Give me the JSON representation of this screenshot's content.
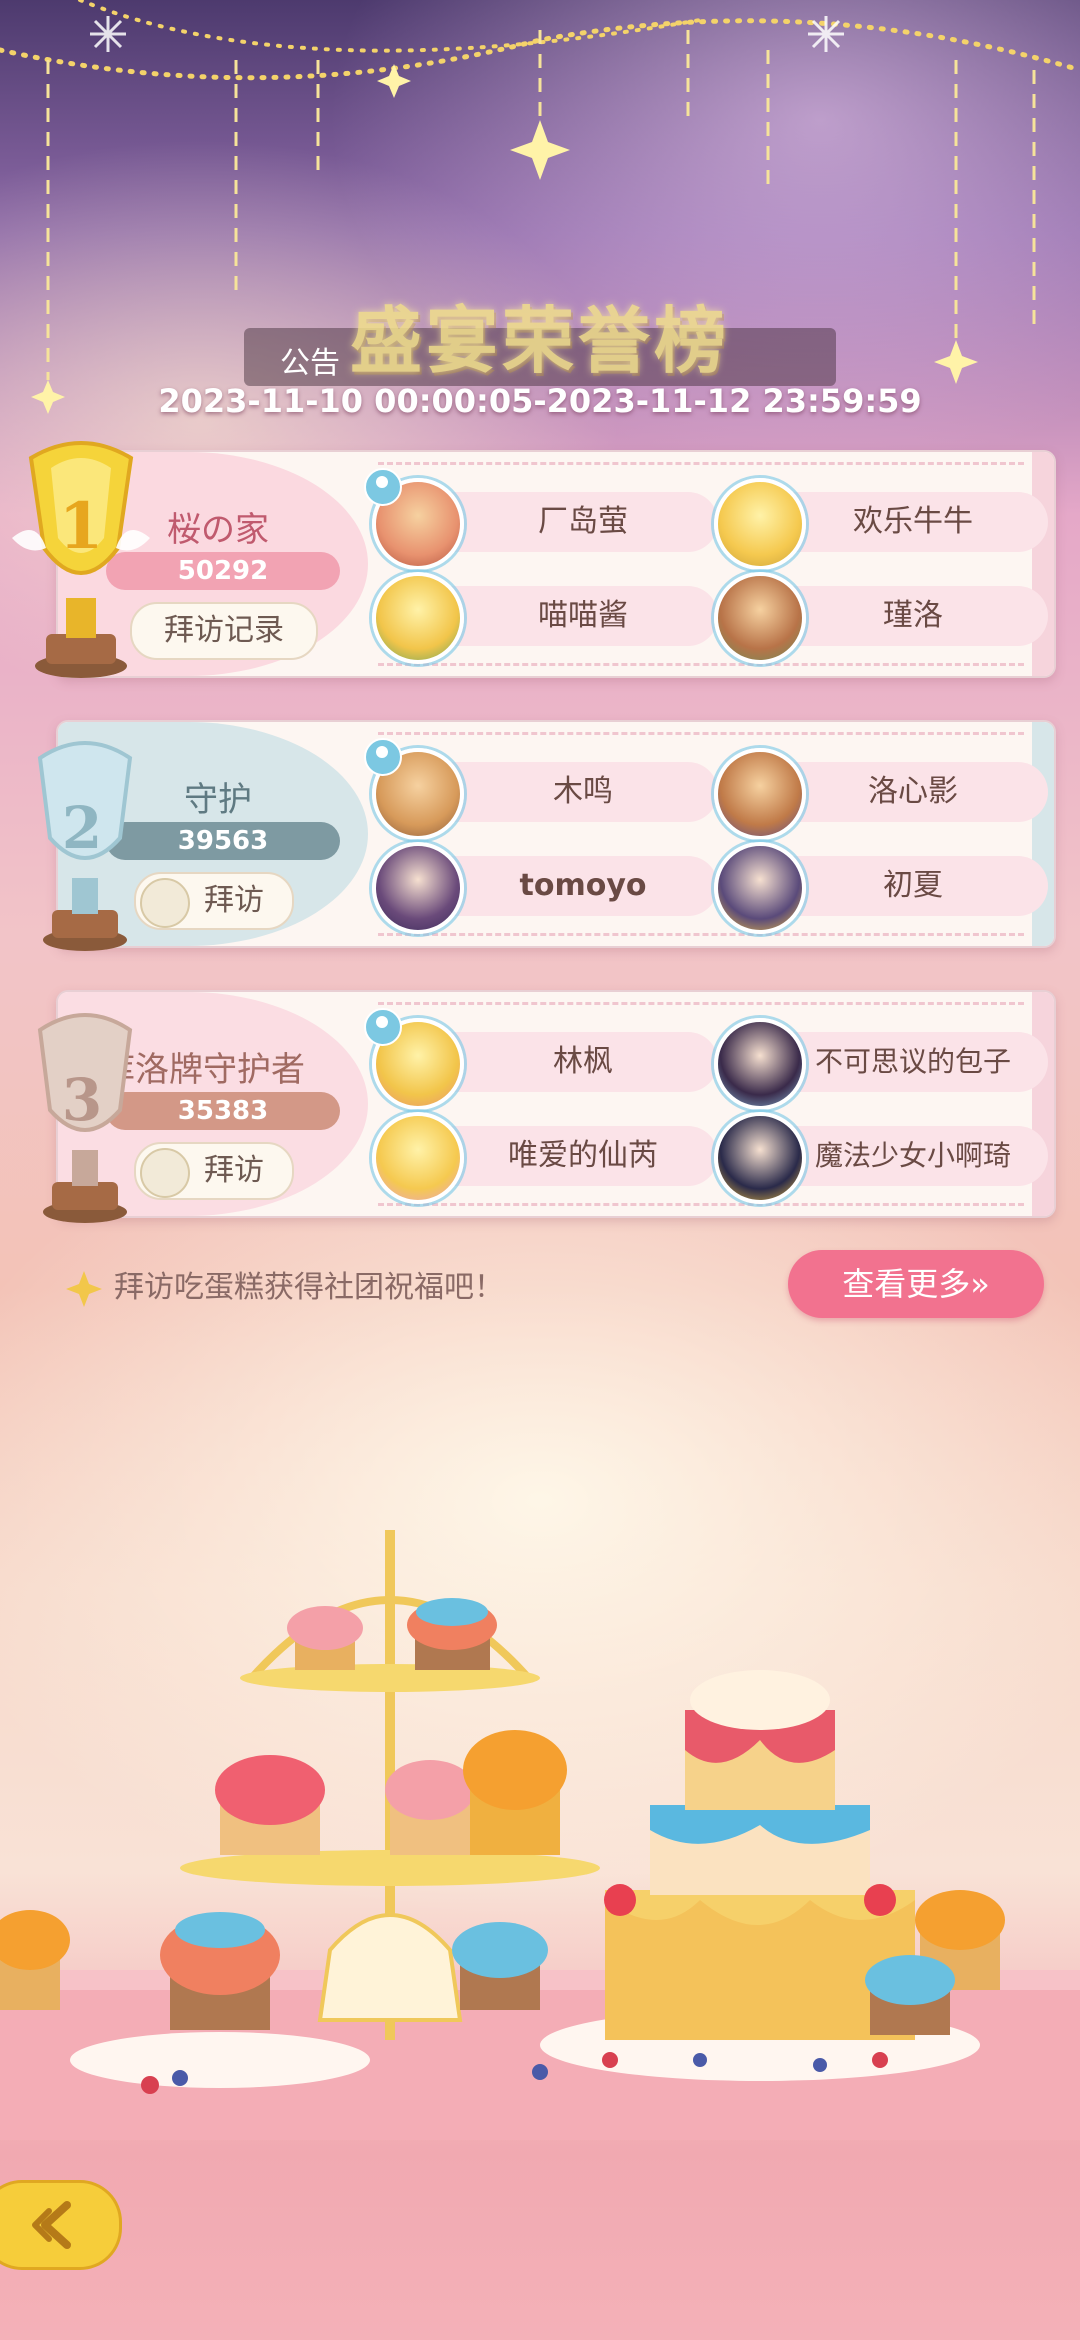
{
  "header": {
    "title": "盛宴荣誉榜",
    "notice_label": "公告",
    "date_range": "2023-11-10 00:00:05-2023-11-12 23:59:59"
  },
  "ranks": [
    {
      "rank": "1",
      "guild_name": "桜の家",
      "score": "50292",
      "visit_label": "拜访记录",
      "members": [
        "厂岛萤",
        "欢乐牛牛",
        "喵喵酱",
        "瑾洛"
      ]
    },
    {
      "rank": "2",
      "guild_name": "守护",
      "score": "39563",
      "visit_label": "拜访",
      "members": [
        "木鸣",
        "洛心影",
        "tomoyo",
        "初夏"
      ]
    },
    {
      "rank": "3",
      "guild_name": "库洛牌守护者",
      "score": "35383",
      "visit_label": "拜访",
      "members": [
        "林枫",
        "不可思议的包子",
        "唯爱的仙芮",
        "魔法少女小啊琦"
      ]
    }
  ],
  "footer": {
    "tip": "拜访吃蛋糕获得社团祝福吧！",
    "more_button": "查看更多»"
  },
  "icons": {
    "back": "back-arrow-icon",
    "sparkle": "sparkle-icon",
    "house": "house-icon"
  },
  "colors": {
    "gold_pill": "#f2a3b3",
    "silver_pill": "#7e9aa2",
    "bronze_pill": "#d39887",
    "more_button": "#f2728f"
  }
}
